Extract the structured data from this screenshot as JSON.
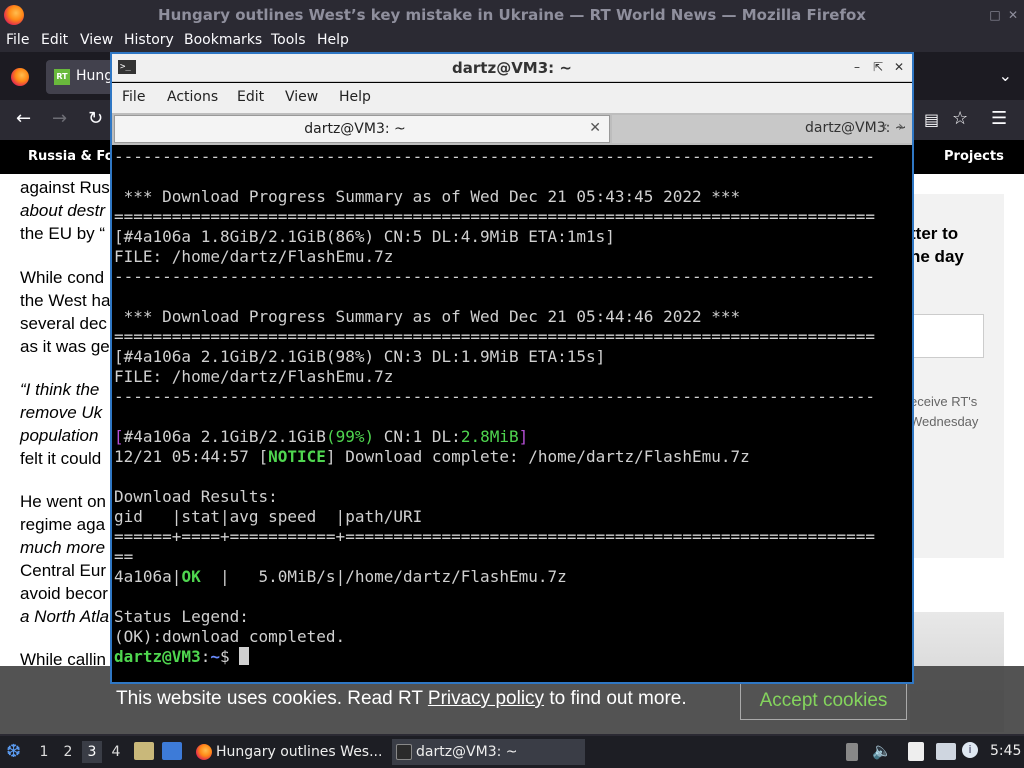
{
  "firefox": {
    "window_title": "Hungary outlines West’s key mistake in Ukraine — RT World News — Mozilla Firefox",
    "menu": [
      "File",
      "Edit",
      "View",
      "History",
      "Bookmarks",
      "Tools",
      "Help"
    ],
    "tab_label": "Hung",
    "nav_left": "Russia & Forr",
    "nav_right": "Projects"
  },
  "article": {
    "p1": [
      "against Rus",
      "about destr",
      "the EU by “"
    ],
    "p2": [
      "While cond",
      "the West ha",
      "several dec",
      "as it was ge"
    ],
    "p3": [
      "“I think the",
      "remove Uk",
      "population ",
      "felt it could "
    ],
    "p4": [
      "He went on",
      "regime aga",
      "much more",
      "Central Eur",
      "avoid becor",
      "a North Atla"
    ],
    "p5": "While callin",
    "aside_heading": [
      "tter to",
      "ne day"
    ],
    "aside_note": [
      "eceive RT's",
      "Wednesday"
    ]
  },
  "cookie": {
    "text_before": "This website uses cookies. Read RT ",
    "link": "Privacy policy",
    "text_after": " to find out more.",
    "accept": "Accept cookies"
  },
  "terminal": {
    "title": "dartz@VM3: ~",
    "menu": [
      "File",
      "Actions",
      "Edit",
      "View",
      "Help"
    ],
    "tab1": "dartz@VM3: ~",
    "tab2": "dartz@VM3: ~",
    "lines": {
      "l1": "-------------------------------------------------------------------------------",
      "l2": " *** Download Progress Summary as of Wed Dec 21 05:43:45 2022 ***",
      "l3": "===============================================================================",
      "l4": "[#4a106a 1.8GiB/2.1GiB(86%) CN:5 DL:4.9MiB ETA:1m1s]",
      "l5": "FILE: /home/dartz/FlashEmu.7z",
      "l6": "-------------------------------------------------------------------------------",
      "l7": " *** Download Progress Summary as of Wed Dec 21 05:44:46 2022 ***",
      "l8": "===============================================================================",
      "l9": "[#4a106a 2.1GiB/2.1GiB(98%) CN:3 DL:1.9MiB ETA:15s]",
      "l10": "FILE: /home/dartz/FlashEmu.7z",
      "l11": "-------------------------------------------------------------------------------",
      "p12_a": "[",
      "p12_b": "#4a106a 2.1GiB/2.1GiB",
      "p12_c": "(99%)",
      "p12_d": " CN:1 DL:",
      "p12_e": "2.8MiB",
      "p12_f": "]",
      "p13_a": "12/21 05:44:57 [",
      "p13_b": "NOTICE",
      "p13_c": "] Download complete: /home/dartz/FlashEmu.7z",
      "l14": "Download Results:",
      "l15": "gid   |stat|avg speed  |path/URI",
      "l16": "======+====+===========+=======================================================",
      "l17": "==",
      "p18_a": "4a106a|",
      "p18_b": "OK",
      "p18_c": "  |   5.0MiB/s|/home/dartz/FlashEmu.7z",
      "l19": "Status Legend:",
      "l20": "(OK):download completed.",
      "prompt_user": "dartz@VM3",
      "prompt_sep": ":",
      "prompt_path": "~",
      "prompt_sym": "$ "
    }
  },
  "taskbar": {
    "workspaces": [
      "1",
      "2",
      "3",
      "4"
    ],
    "active_workspace": "3",
    "task_firefox": "Hungary outlines Wes...",
    "task_terminal": "dartz@VM3: ~",
    "clock": "5:45"
  }
}
